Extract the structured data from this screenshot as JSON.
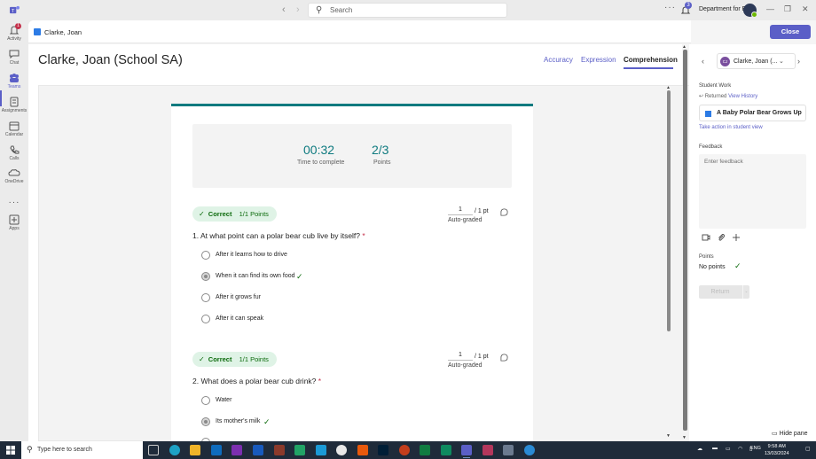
{
  "titlebar": {
    "search_placeholder": "Search",
    "notification_count": "3",
    "org_name": "Department for E..."
  },
  "rail": [
    {
      "label": "Activity",
      "icon": "bell-icon",
      "badge": "1"
    },
    {
      "label": "Chat",
      "icon": "chat-icon"
    },
    {
      "label": "Teams",
      "icon": "teams-icon",
      "active": true
    },
    {
      "label": "Assignments",
      "icon": "assignments-icon"
    },
    {
      "label": "Calendar",
      "icon": "calendar-icon"
    },
    {
      "label": "Calls",
      "icon": "phone-icon"
    },
    {
      "label": "OneDrive",
      "icon": "cloud-icon"
    },
    {
      "label": "",
      "icon": "more-icon"
    },
    {
      "label": "Apps",
      "icon": "apps-icon"
    }
  ],
  "header": {
    "student_tab": "Clarke, Joan",
    "close_label": "Close"
  },
  "main": {
    "title": "Clarke, Joan (School SA)",
    "tabs": [
      "Accuracy",
      "Expression",
      "Comprehension"
    ],
    "active_tab": "Comprehension"
  },
  "form": {
    "accent": "#0e7a7f",
    "time_value": "00:32",
    "time_label": "Time to complete",
    "points_value": "2/3",
    "points_label": "Points",
    "questions": [
      {
        "status": "Correct",
        "points_badge": "1/1 Points",
        "score": "1",
        "max": "/ 1 pt",
        "graded": "Auto-graded",
        "number": "1.",
        "text": "At what point can a polar bear cub live by itself?",
        "required": "*",
        "options": [
          {
            "label": "After it learns how to drive",
            "selected": false,
            "correct": false
          },
          {
            "label": "When it can find its own food",
            "selected": true,
            "correct": true
          },
          {
            "label": "After it grows fur",
            "selected": false,
            "correct": false
          },
          {
            "label": "After it can speak",
            "selected": false,
            "correct": false
          }
        ]
      },
      {
        "status": "Correct",
        "points_badge": "1/1 Points",
        "score": "1",
        "max": "/ 1 pt",
        "graded": "Auto-graded",
        "number": "2.",
        "text": "What does a polar bear cub drink?",
        "required": "*",
        "options": [
          {
            "label": "Water",
            "selected": false,
            "correct": false
          },
          {
            "label": "Its mother's milk",
            "selected": true,
            "correct": true
          }
        ]
      }
    ]
  },
  "panel": {
    "avatar_initials": "CJ",
    "student_name": "Clarke, Joan (...",
    "student_work_label": "Student Work",
    "returned_label": "Returned",
    "view_history": "View History",
    "work_title": "A Baby Polar Bear Grows Up",
    "take_action": "Take action in student view",
    "feedback_label": "Feedback",
    "feedback_placeholder": "Enter feedback",
    "points_label": "Points",
    "points_value": "No points",
    "return_label": "Return",
    "hide_pane": "Hide pane"
  },
  "taskbar": {
    "search_placeholder": "Type here to search",
    "language": "ENG",
    "time": "9:58 AM",
    "date": "13/03/2024"
  },
  "colors": {
    "brand": "#5b5fc7",
    "correct_bg": "#dff3e6",
    "correct_text": "#0b6a0b",
    "taskbar": "#1f2b3a"
  }
}
